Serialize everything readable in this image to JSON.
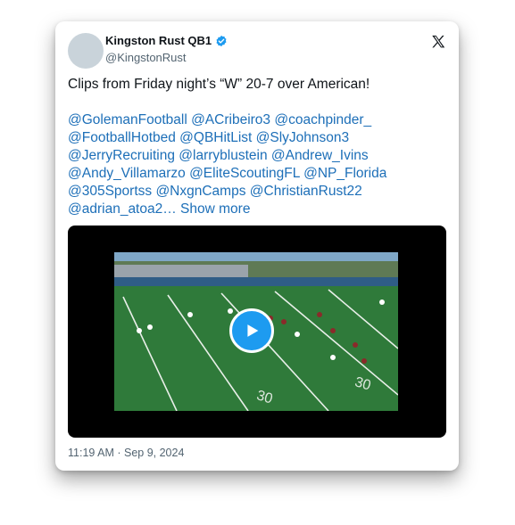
{
  "author": {
    "display_name": "Kingston Rust QB1",
    "handle": "@KingstonRust",
    "verified": true,
    "verified_color": "#1d9bf0"
  },
  "tweet": {
    "headline": "Clips from Friday night’s “W” 20-7 over American!",
    "mention_lines": [
      "@GolemanFootball @ACribeiro3 @coachpinder_",
      "@FootballHotbed @QBHitList @SlyJohnson3",
      "@JerryRecruiting @larryblustein @Andrew_Ivins",
      "@Andy_Villamarzo @EliteScoutingFL @NP_Florida",
      "@305Sportss @NxgnCamps @ChristianRust22"
    ],
    "last_line_mention": "@adrian_atoa2…",
    "show_more_label": "Show more",
    "link_color": "#1d6fb8"
  },
  "media": {
    "type": "video",
    "play_icon": "play-icon",
    "play_color": "#1d9bf0"
  },
  "timestamp": "11:19 AM · Sep 9, 2024",
  "icons": {
    "platform_logo": "x-logo-icon",
    "verified_badge": "verified-badge-icon"
  }
}
